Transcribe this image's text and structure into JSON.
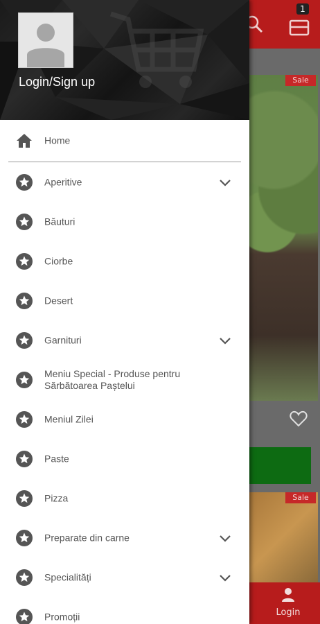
{
  "app": {
    "cart_count": "1",
    "sale_label_1": "Sale",
    "sale_label_2": "Sale",
    "bottom_nav_login": "Login"
  },
  "drawer": {
    "login_label": "Login/Sign up",
    "home_label": "Home",
    "items": [
      {
        "label": "Aperitive",
        "icon": "star-icon",
        "expandable": true
      },
      {
        "label": "Băuturi",
        "icon": "star-icon",
        "expandable": false
      },
      {
        "label": "Ciorbe",
        "icon": "star-icon",
        "expandable": false
      },
      {
        "label": "Desert",
        "icon": "star-icon",
        "expandable": false
      },
      {
        "label": "Garnituri",
        "icon": "star-icon",
        "expandable": true
      },
      {
        "label": "Meniu Special  - Produse pentru Sărbătoarea Paștelui",
        "icon": "star-icon",
        "expandable": false
      },
      {
        "label": "Meniul Zilei",
        "icon": "star-icon",
        "expandable": false
      },
      {
        "label": "Paste",
        "icon": "star-icon",
        "expandable": false
      },
      {
        "label": "Pizza",
        "icon": "star-icon",
        "expandable": false
      },
      {
        "label": "Preparate din carne",
        "icon": "star-icon",
        "expandable": true
      },
      {
        "label": "Specialități",
        "icon": "star-icon",
        "expandable": true
      },
      {
        "label": "Promoții",
        "icon": "star-icon",
        "expandable": false
      }
    ]
  },
  "colors": {
    "brand_red": "#b71c1c",
    "icon_gray": "#555555",
    "action_green": "#0d6b12"
  }
}
